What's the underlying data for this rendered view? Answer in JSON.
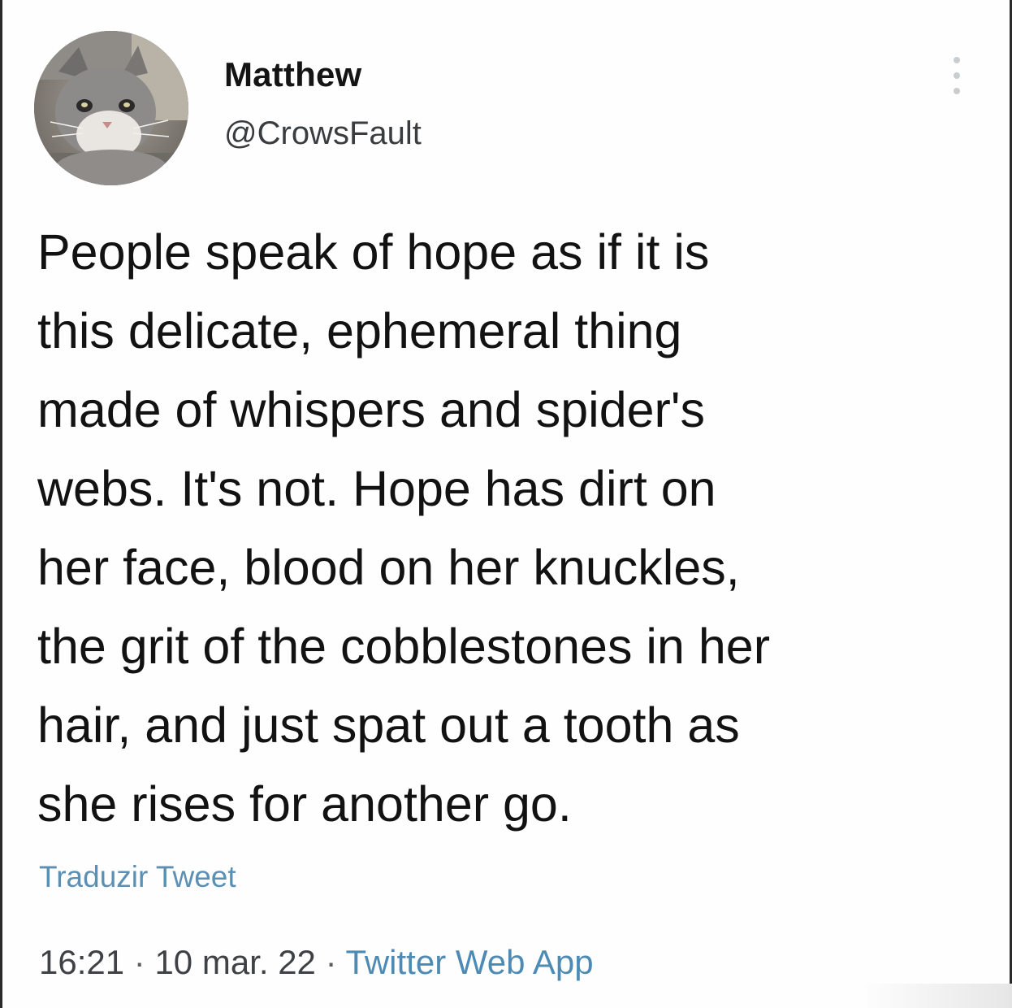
{
  "tweet": {
    "author": {
      "display_name": "Matthew",
      "handle": "@CrowsFault",
      "avatar_icon": "cat-avatar-icon"
    },
    "more_options_icon": "vertical-dots-icon",
    "text_lines": [
      "People speak of hope as if it is",
      "this delicate, ephemeral thing",
      "made of whispers and spider's",
      "webs. It's not. Hope has dirt on",
      "her face, blood on her knuckles,",
      "the grit of the cobblestones in her",
      "hair, and just spat out a tooth as",
      "she rises for another go."
    ],
    "translate_label": "Traduzir Tweet",
    "meta": {
      "time": "16:21",
      "separator": "·",
      "date": "10 mar. 22",
      "source": "Twitter Web App"
    }
  },
  "colors": {
    "text": "#121212",
    "handle": "#3a3d40",
    "link": "#5b8fb3",
    "meta": "#3e4246",
    "dots": "#c9cdd1"
  }
}
